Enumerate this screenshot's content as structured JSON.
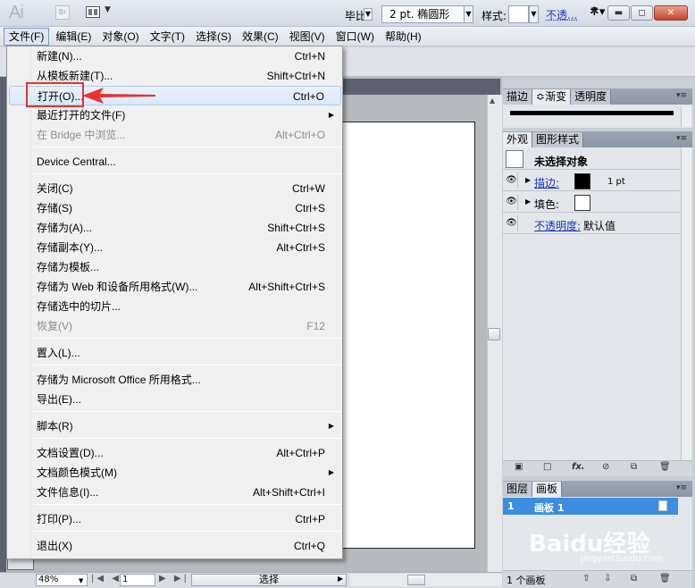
{
  "titlebar": {
    "app_logo": "Ai",
    "bridge_label": "Br"
  },
  "menubar": {
    "items": [
      "文件(F)",
      "编辑(E)",
      "对象(O)",
      "文字(T)",
      "选择(S)",
      "效果(C)",
      "视图(V)",
      "窗口(W)",
      "帮助(H)"
    ],
    "active_index": 0
  },
  "controlbar": {
    "stroke_label_fragment": "毕比",
    "brush": "2 pt. 椭圆形",
    "style_label": "样式:",
    "opacity_link": "不透..."
  },
  "file_menu": {
    "items": [
      {
        "label": "新建(N)...",
        "shortcut": "Ctrl+N"
      },
      {
        "label": "从模板新建(T)...",
        "shortcut": "Shift+Ctrl+N"
      },
      {
        "label": "打开(O)...",
        "shortcut": "Ctrl+O",
        "hover": true
      },
      {
        "label": "最近打开的文件(F)",
        "shortcut": "",
        "submenu": true
      },
      {
        "label": "在 Bridge 中浏览...",
        "shortcut": "Alt+Ctrl+O",
        "disabled": true
      },
      {
        "label": "Device Central...",
        "shortcut": ""
      },
      {
        "label": "关闭(C)",
        "shortcut": "Ctrl+W"
      },
      {
        "label": "存储(S)",
        "shortcut": "Ctrl+S"
      },
      {
        "label": "存储为(A)...",
        "shortcut": "Shift+Ctrl+S"
      },
      {
        "label": "存储副本(Y)...",
        "shortcut": "Alt+Ctrl+S"
      },
      {
        "label": "存储为模板...",
        "shortcut": ""
      },
      {
        "label": "存储为 Web 和设备所用格式(W)...",
        "shortcut": "Alt+Shift+Ctrl+S"
      },
      {
        "label": "存储选中的切片...",
        "shortcut": ""
      },
      {
        "label": "恢复(V)",
        "shortcut": "F12",
        "disabled": true
      },
      {
        "label": "置入(L)...",
        "shortcut": ""
      },
      {
        "label": "存储为 Microsoft Office 所用格式...",
        "shortcut": ""
      },
      {
        "label": "导出(E)...",
        "shortcut": ""
      },
      {
        "label": "脚本(R)",
        "shortcut": "",
        "submenu": true
      },
      {
        "label": "文档设置(D)...",
        "shortcut": "Alt+Ctrl+P"
      },
      {
        "label": "文档颜色模式(M)",
        "shortcut": "",
        "submenu": true
      },
      {
        "label": "文件信息(I)...",
        "shortcut": "Alt+Shift+Ctrl+I"
      },
      {
        "label": "打印(P)...",
        "shortcut": "Ctrl+P"
      },
      {
        "label": "退出(X)",
        "shortcut": "Ctrl+Q"
      }
    ]
  },
  "panels": {
    "top_tabs": [
      "描边",
      "≎渐变",
      "透明度"
    ],
    "appearance_tabs": [
      "外观",
      "图形样式"
    ],
    "appearance": {
      "header": "未选择对象",
      "stroke_label": "描边:",
      "stroke_weight": "1 pt",
      "fill_label": "填色:",
      "opacity_label": "不透明度:",
      "opacity_value": "默认值"
    },
    "layers_tabs": [
      "图层",
      "画板"
    ],
    "artboards": [
      {
        "num": "1",
        "name": "画板 1"
      }
    ],
    "artboard_count": "1 个画板"
  },
  "statusbar": {
    "zoom": "48%",
    "page": "1",
    "status_text": "选择"
  },
  "watermark": {
    "logo": "Baidu经验",
    "url": "jingyan.baidu.com"
  },
  "colors": {
    "highlight_box": "#e8322f",
    "selected_row": "#3d8ee0",
    "link": "#1a37b5"
  }
}
